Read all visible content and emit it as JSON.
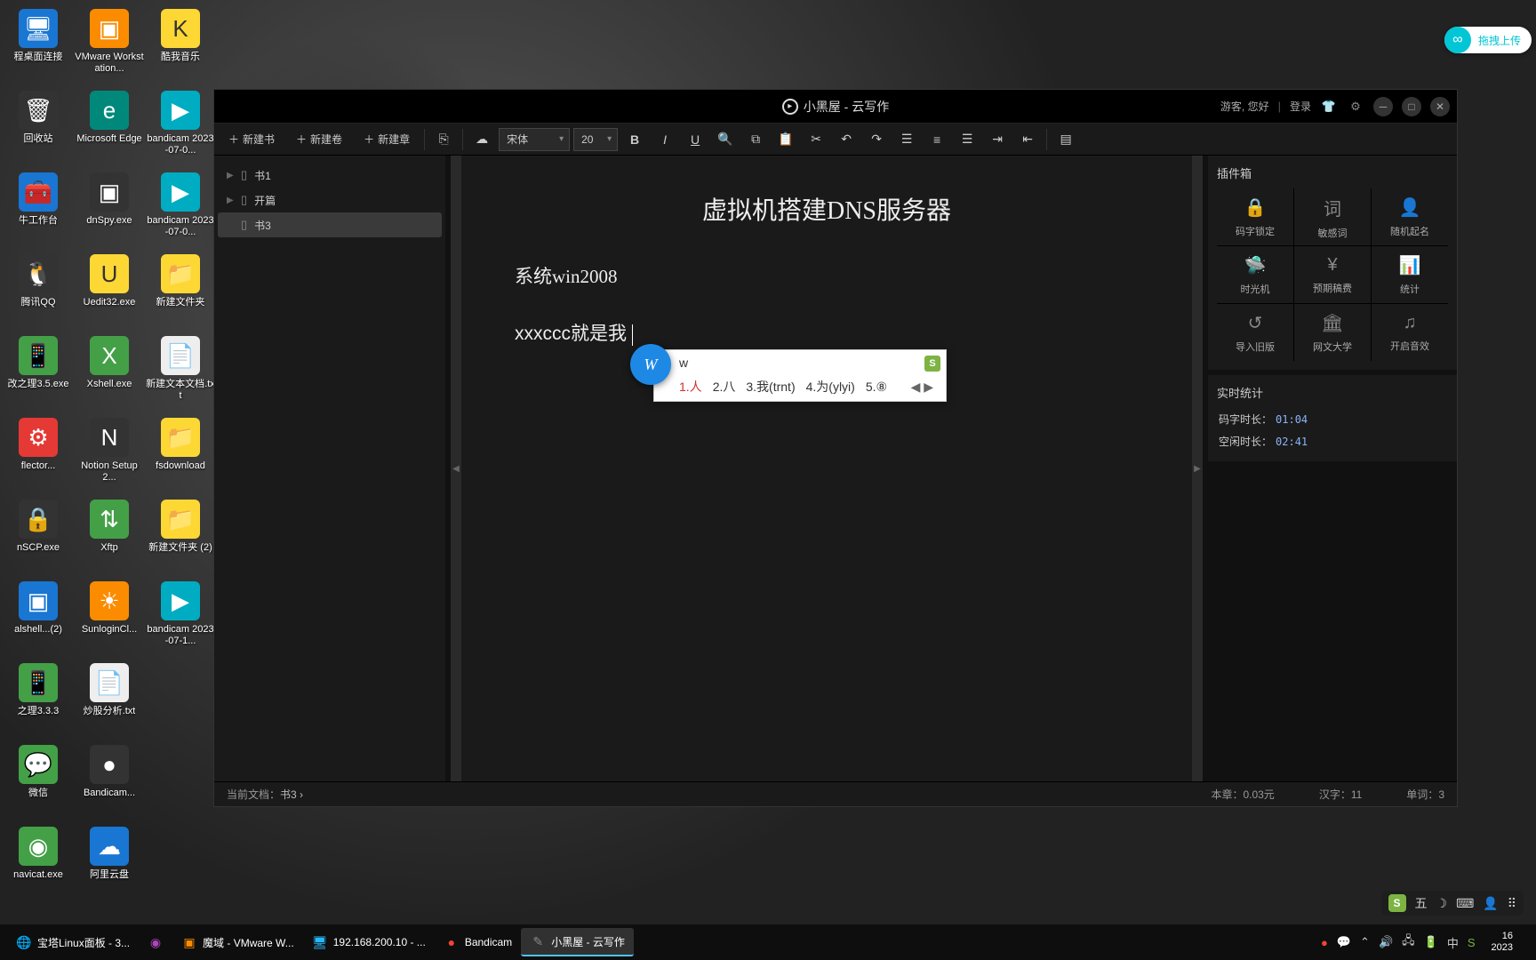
{
  "upload_badge": "拖拽上传",
  "desktop_icons": [
    {
      "label": "程桌面连接",
      "color": "c-blue",
      "glyph": "🖥"
    },
    {
      "label": "回收站",
      "color": "c-dark",
      "glyph": "🗑"
    },
    {
      "label": "牛工作台",
      "color": "c-blue",
      "glyph": "🧰"
    },
    {
      "label": "腾讯QQ",
      "color": "c-dark",
      "glyph": "🐧"
    },
    {
      "label": "改之理3.5.exe",
      "color": "c-green",
      "glyph": "📱"
    },
    {
      "label": "flector...",
      "color": "c-red",
      "glyph": "⚙"
    },
    {
      "label": "nSCP.exe",
      "color": "c-dark",
      "glyph": "🔒"
    },
    {
      "label": "alshell...(2)",
      "color": "c-blue",
      "glyph": "▣"
    },
    {
      "label": "之理3.3.3",
      "color": "c-green",
      "glyph": "📱"
    },
    {
      "label": "微信",
      "color": "c-green",
      "glyph": "💬"
    },
    {
      "label": "navicat.exe",
      "color": "c-green",
      "glyph": "◉"
    },
    {
      "label": "VMware Workstation...",
      "color": "c-orange",
      "glyph": "▣"
    },
    {
      "label": "Microsoft Edge",
      "color": "c-teal",
      "glyph": "e"
    },
    {
      "label": "dnSpy.exe",
      "color": "c-dark",
      "glyph": "▣"
    },
    {
      "label": "Uedit32.exe",
      "color": "c-yellow",
      "glyph": "U"
    },
    {
      "label": "Xshell.exe",
      "color": "c-green",
      "glyph": "X"
    },
    {
      "label": "Notion Setup 2...",
      "color": "c-dark",
      "glyph": "N"
    },
    {
      "label": "Xftp",
      "color": "c-green",
      "glyph": "⇅"
    },
    {
      "label": "SunloginCl...",
      "color": "c-orange",
      "glyph": "☀"
    },
    {
      "label": "炒股分析.txt",
      "color": "c-white",
      "glyph": "📄"
    },
    {
      "label": "Bandicam...",
      "color": "c-dark",
      "glyph": "●"
    },
    {
      "label": "阿里云盘",
      "color": "c-blue",
      "glyph": "☁"
    },
    {
      "label": "酷我音乐",
      "color": "c-yellow",
      "glyph": "K"
    },
    {
      "label": "bandicam 2023-07-0...",
      "color": "c-cyan",
      "glyph": "▶"
    },
    {
      "label": "bandicam 2023-07-0...",
      "color": "c-cyan",
      "glyph": "▶"
    },
    {
      "label": "新建文件夹",
      "color": "c-yellow",
      "glyph": "📁"
    },
    {
      "label": "新建文本文档.txt",
      "color": "c-white",
      "glyph": "📄"
    },
    {
      "label": "fsdownload",
      "color": "c-yellow",
      "glyph": "📁"
    },
    {
      "label": "新建文件夹 (2)",
      "color": "c-yellow",
      "glyph": "📁"
    },
    {
      "label": "bandicam 2023-07-1...",
      "color": "c-cyan",
      "glyph": "▶"
    }
  ],
  "app": {
    "title": "小黑屋 - 云写作",
    "guest": "游客, 您好",
    "login": "登录",
    "toolbar": {
      "new_book": "新建书",
      "new_volume": "新建卷",
      "new_chapter": "新建章",
      "font": "宋体",
      "size": "20"
    },
    "sidebar": [
      {
        "label": "书1",
        "sel": false
      },
      {
        "label": "开篇",
        "sel": false
      },
      {
        "label": "书3",
        "sel": true
      }
    ],
    "doc": {
      "title": "虚拟机搭建DNS服务器",
      "line1": "系统win2008",
      "line2": "xxxccc就是我"
    },
    "ime": {
      "input": "w",
      "candidates": [
        "1.人",
        "2.八",
        "3.我(trnt)",
        "4.为(ylyi)",
        "5.⑧"
      ]
    },
    "plugins_title": "插件箱",
    "plugins": [
      {
        "icon": "🔒",
        "label": "码字锁定"
      },
      {
        "icon": "词",
        "label": "敏感词"
      },
      {
        "icon": "👤",
        "label": "随机起名"
      },
      {
        "icon": "🛸",
        "label": "时光机"
      },
      {
        "icon": "¥",
        "label": "预期稿费"
      },
      {
        "icon": "📊",
        "label": "统计"
      },
      {
        "icon": "↺",
        "label": "导入旧版"
      },
      {
        "icon": "🏛",
        "label": "网文大学"
      },
      {
        "icon": "♫",
        "label": "开启音效"
      }
    ],
    "realtime_title": "实时统计",
    "stat_typing_label": "码字时长：",
    "stat_typing_val": "01:04",
    "stat_idle_label": "空闲时长：",
    "stat_idle_val": "02:41",
    "status": {
      "doc_label": "当前文档：",
      "doc_val": "书3 ›",
      "chapter_label": "本章：",
      "chapter_val": "0.03元",
      "chars_label": "汉字：",
      "chars_val": "11",
      "words_label": "单词：",
      "words_val": "3"
    }
  },
  "ime_float": "五",
  "taskbar": [
    {
      "label": "宝塔Linux面板 - 3...",
      "glyph": "🌐",
      "color": "#e65100"
    },
    {
      "label": "",
      "glyph": "◉",
      "color": "#ab47bc"
    },
    {
      "label": "魔域 - VMware W...",
      "glyph": "▣",
      "color": "#fb8c00"
    },
    {
      "label": "192.168.200.10 - ...",
      "glyph": "🖥",
      "color": "#29b6f6"
    },
    {
      "label": "Bandicam",
      "glyph": "●",
      "color": "#f44336"
    },
    {
      "label": "小黑屋 - 云写作",
      "glyph": "✎",
      "color": "#888",
      "active": true
    }
  ],
  "clock": {
    "time": "16",
    "date": "2023"
  }
}
